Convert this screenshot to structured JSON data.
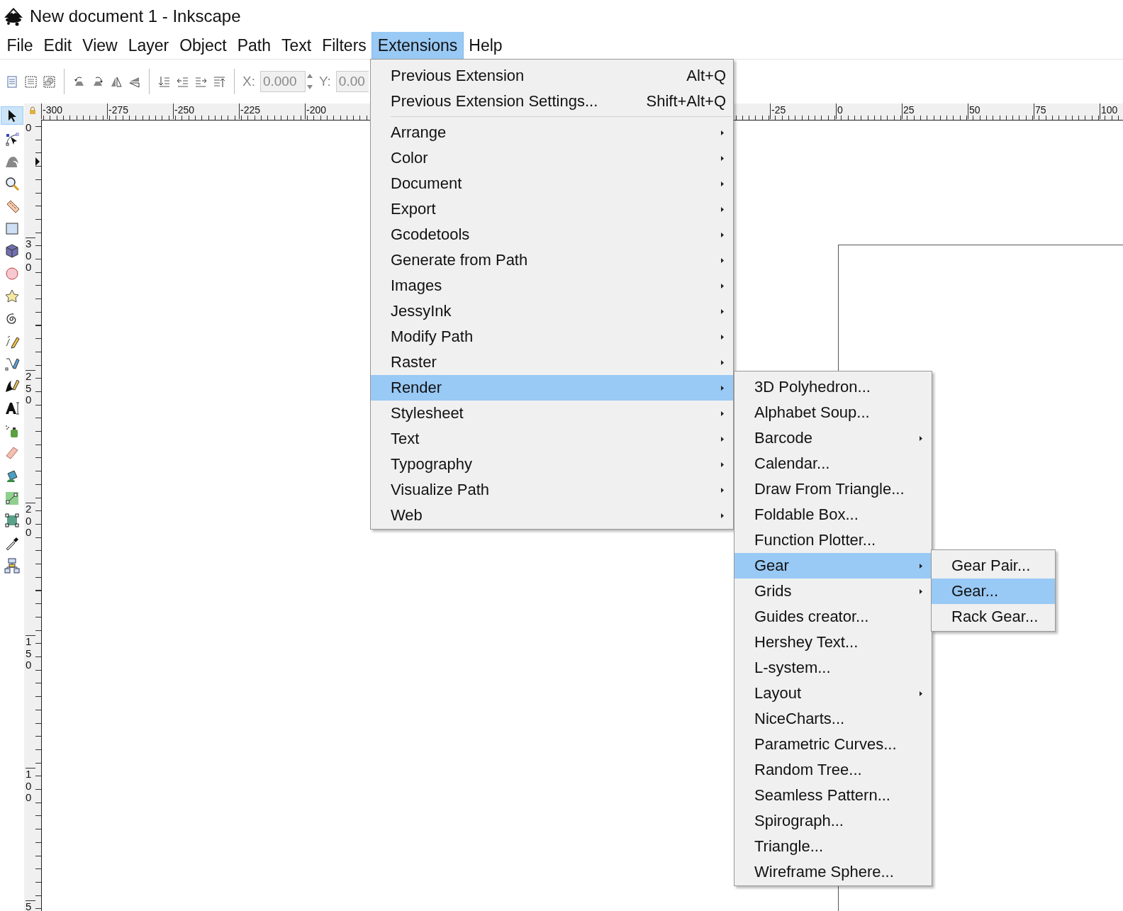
{
  "window": {
    "title": "New document 1 - Inkscape"
  },
  "menubar": [
    {
      "label": "File",
      "selected": false
    },
    {
      "label": "Edit",
      "selected": false
    },
    {
      "label": "View",
      "selected": false
    },
    {
      "label": "Layer",
      "selected": false
    },
    {
      "label": "Object",
      "selected": false
    },
    {
      "label": "Path",
      "selected": false
    },
    {
      "label": "Text",
      "selected": false
    },
    {
      "label": "Filters",
      "selected": false
    },
    {
      "label": "Extensions",
      "selected": true
    },
    {
      "label": "Help",
      "selected": false
    }
  ],
  "toolbar": {
    "x_field": {
      "label": "X:",
      "value": "0.000"
    },
    "y_field": {
      "label": "Y:",
      "value": "0.00"
    }
  },
  "toolbox": [
    {
      "selected": true
    },
    {
      "selected": false
    },
    {
      "selected": false
    },
    {
      "selected": false
    },
    {
      "selected": false
    },
    {
      "selected": false
    },
    {
      "selected": false
    },
    {
      "selected": false
    },
    {
      "selected": false
    },
    {
      "selected": false
    },
    {
      "selected": false
    },
    {
      "selected": false
    },
    {
      "selected": false
    },
    {
      "selected": false
    },
    {
      "selected": false
    },
    {
      "selected": false
    },
    {
      "selected": false
    },
    {
      "selected": false
    },
    {
      "selected": false
    },
    {
      "selected": false
    },
    {
      "selected": false
    }
  ],
  "horizontal_ruler": {
    "left_labels": [
      "-300",
      "-275",
      "-250",
      "-225",
      "-200"
    ],
    "right_labels": [
      "-25",
      "0",
      "25",
      "50",
      "75",
      "100"
    ]
  },
  "vertical_ruler": {
    "labels": [
      "0",
      "300",
      "250",
      "200",
      "150",
      "100",
      "5"
    ]
  },
  "extensions_menu": [
    {
      "kind": "item",
      "label": "Previous Extension",
      "shortcut": "Alt+Q",
      "selected": false
    },
    {
      "kind": "item",
      "label": "Previous Extension Settings...",
      "shortcut": "Shift+Alt+Q",
      "selected": false
    },
    {
      "kind": "separator"
    },
    {
      "kind": "submenu",
      "label": "Arrange",
      "selected": false
    },
    {
      "kind": "submenu",
      "label": "Color",
      "selected": false
    },
    {
      "kind": "submenu",
      "label": "Document",
      "selected": false
    },
    {
      "kind": "submenu",
      "label": "Export",
      "selected": false
    },
    {
      "kind": "submenu",
      "label": "Gcodetools",
      "selected": false
    },
    {
      "kind": "submenu",
      "label": "Generate from Path",
      "selected": false
    },
    {
      "kind": "submenu",
      "label": "Images",
      "selected": false
    },
    {
      "kind": "submenu",
      "label": "JessyInk",
      "selected": false
    },
    {
      "kind": "submenu",
      "label": "Modify Path",
      "selected": false
    },
    {
      "kind": "submenu",
      "label": "Raster",
      "selected": false
    },
    {
      "kind": "submenu",
      "label": "Render",
      "selected": true
    },
    {
      "kind": "submenu",
      "label": "Stylesheet",
      "selected": false
    },
    {
      "kind": "submenu",
      "label": "Text",
      "selected": false
    },
    {
      "kind": "submenu",
      "label": "Typography",
      "selected": false
    },
    {
      "kind": "submenu",
      "label": "Visualize Path",
      "selected": false
    },
    {
      "kind": "submenu",
      "label": "Web",
      "selected": false
    }
  ],
  "render_menu": [
    {
      "kind": "item",
      "label": "3D Polyhedron...",
      "selected": false
    },
    {
      "kind": "item",
      "label": "Alphabet Soup...",
      "selected": false
    },
    {
      "kind": "submenu",
      "label": "Barcode",
      "selected": false
    },
    {
      "kind": "item",
      "label": "Calendar...",
      "selected": false
    },
    {
      "kind": "item",
      "label": "Draw From Triangle...",
      "selected": false
    },
    {
      "kind": "item",
      "label": "Foldable Box...",
      "selected": false
    },
    {
      "kind": "item",
      "label": "Function Plotter...",
      "selected": false
    },
    {
      "kind": "submenu",
      "label": "Gear",
      "selected": true
    },
    {
      "kind": "submenu",
      "label": "Grids",
      "selected": false
    },
    {
      "kind": "item",
      "label": "Guides creator...",
      "selected": false
    },
    {
      "kind": "item",
      "label": "Hershey Text...",
      "selected": false
    },
    {
      "kind": "item",
      "label": "L-system...",
      "selected": false
    },
    {
      "kind": "submenu",
      "label": "Layout",
      "selected": false
    },
    {
      "kind": "item",
      "label": "NiceCharts...",
      "selected": false
    },
    {
      "kind": "item",
      "label": "Parametric Curves...",
      "selected": false
    },
    {
      "kind": "item",
      "label": "Random Tree...",
      "selected": false
    },
    {
      "kind": "item",
      "label": "Seamless Pattern...",
      "selected": false
    },
    {
      "kind": "item",
      "label": "Spirograph...",
      "selected": false
    },
    {
      "kind": "item",
      "label": "Triangle...",
      "selected": false
    },
    {
      "kind": "item",
      "label": "Wireframe Sphere...",
      "selected": false
    }
  ],
  "gear_menu": [
    {
      "kind": "item",
      "label": "Gear Pair...",
      "selected": false
    },
    {
      "kind": "item",
      "label": "Gear...",
      "selected": true
    },
    {
      "kind": "item",
      "label": "Rack Gear...",
      "selected": false
    }
  ]
}
